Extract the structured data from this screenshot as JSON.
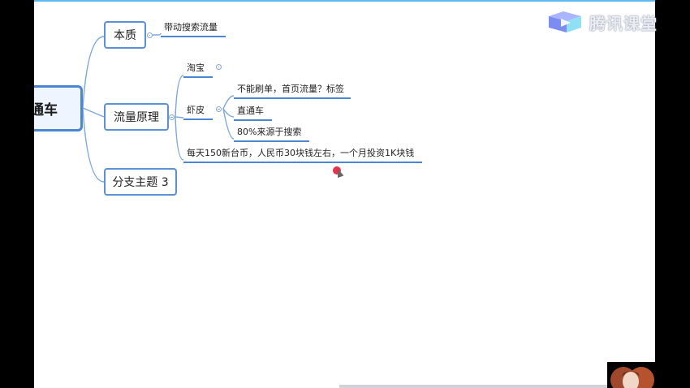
{
  "watermark": {
    "brand_text": "腾讯课堂"
  },
  "mindmap": {
    "root_label": "通车",
    "branches": [
      {
        "label": "本质",
        "children": [
          "带动搜索流量"
        ]
      },
      {
        "label": "流量原理",
        "children": [
          {
            "label": "淘宝",
            "children": []
          },
          {
            "label": "虾皮",
            "children": [
              "不能刷单，首页流量？标签",
              "直通车",
              "80%来源于搜索"
            ]
          },
          {
            "label": "每天150新台币，人民币30块钱左右，一个月投资1K块钱",
            "children": []
          }
        ]
      },
      {
        "label": "分支主题 3",
        "children": []
      }
    ]
  },
  "colors": {
    "node_border": "#5b8fd6",
    "underline": "#4a86d4",
    "top_accent": "#5ab9f0",
    "cursor": "#e8314a"
  }
}
